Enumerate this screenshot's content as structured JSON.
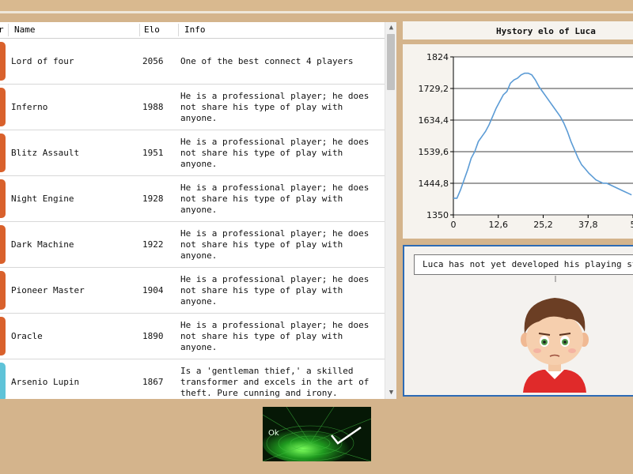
{
  "table": {
    "columns": {
      "rank": "r",
      "name": "Name",
      "elo": "Elo",
      "info": "Info"
    },
    "rows": [
      {
        "name": "Lord of four",
        "elo": "2056",
        "info": "One of the best connect 4 players",
        "color": "#d9612c"
      },
      {
        "name": "Inferno",
        "elo": "1988",
        "info": "He is a professional player; he does not share his type of play with anyone.",
        "color": "#d9612c"
      },
      {
        "name": "Blitz Assault",
        "elo": "1951",
        "info": "He is a professional player; he does not share his type of play with anyone.",
        "color": "#d9612c"
      },
      {
        "name": "Night Engine",
        "elo": "1928",
        "info": "He is a professional player; he does not share his type of play with anyone.",
        "color": "#d9612c"
      },
      {
        "name": "Dark Machine",
        "elo": "1922",
        "info": "He is a professional player; he does not share his type of play with anyone.",
        "color": "#d9612c"
      },
      {
        "name": "Pioneer Master",
        "elo": "1904",
        "info": "He is a professional player; he does not share his type of play with anyone.",
        "color": "#d9612c"
      },
      {
        "name": "Oracle",
        "elo": "1890",
        "info": "He is a professional player; he does not share his type of play with anyone.",
        "color": "#d9612c"
      },
      {
        "name": "Arsenio Lupin",
        "elo": "1867",
        "info": "Is a 'gentleman thief,' a skilled transformer and excels in the art of theft. Pure cunning and irony.",
        "color": "#5fc3d8"
      }
    ]
  },
  "chart_data": {
    "type": "line",
    "title": "Hystory elo of Luca",
    "ylim": [
      1350,
      1824
    ],
    "yticks": [
      "1824",
      "1729,2",
      "1634,4",
      "1539,6",
      "1444,8",
      "1350"
    ],
    "xlim": [
      0,
      50.4
    ],
    "xticks": [
      "0",
      "12,6",
      "25,2",
      "37,8",
      "5"
    ],
    "grid": true,
    "series": [
      {
        "x": [
          0,
          1,
          2,
          3,
          4,
          5,
          6,
          7,
          8,
          9,
          10,
          11,
          12,
          13,
          14,
          15,
          16,
          17,
          18,
          19,
          20,
          21,
          22,
          23,
          24,
          25,
          26,
          27,
          28,
          29,
          30,
          31,
          32,
          33,
          34,
          35,
          36,
          37,
          38,
          39,
          40,
          41,
          42,
          43,
          44,
          45,
          46,
          47,
          48,
          49,
          50
        ],
        "y": [
          1400,
          1400,
          1425,
          1455,
          1485,
          1520,
          1540,
          1570,
          1585,
          1600,
          1620,
          1645,
          1670,
          1690,
          1710,
          1720,
          1745,
          1755,
          1760,
          1770,
          1775,
          1775,
          1770,
          1755,
          1735,
          1720,
          1705,
          1690,
          1675,
          1660,
          1645,
          1625,
          1600,
          1570,
          1545,
          1520,
          1500,
          1488,
          1475,
          1465,
          1455,
          1450,
          1445,
          1445,
          1440,
          1435,
          1430,
          1425,
          1420,
          1415,
          1410
        ],
        "color": "#5b9bd5"
      }
    ]
  },
  "character": {
    "speech": "Luca has not yet developed his playing style"
  },
  "ok_button": {
    "label": "Ok"
  },
  "colors": {
    "panel_border": "#2d6bb5",
    "line": "#5b9bd5",
    "background": "#d4b48c"
  }
}
